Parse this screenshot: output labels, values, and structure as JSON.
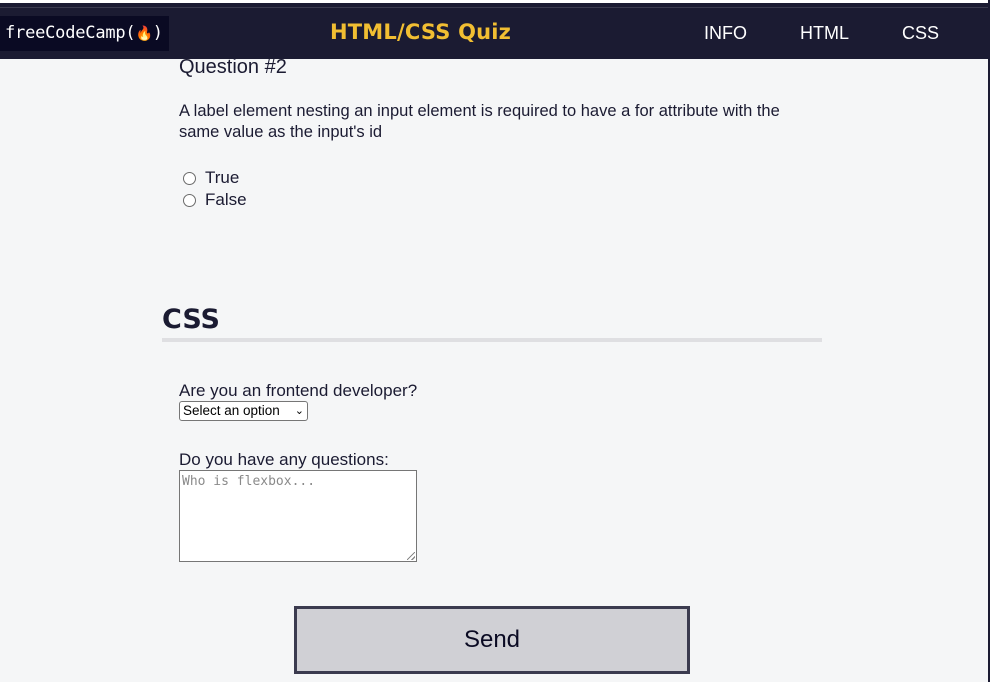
{
  "header": {
    "logo_text": "freeCodeCamp(",
    "logo_flame": "🔥",
    "logo_close": ")",
    "title": "HTML/CSS Quiz",
    "nav": [
      {
        "label": "INFO"
      },
      {
        "label": "HTML"
      },
      {
        "label": "CSS"
      }
    ]
  },
  "question": {
    "title": "Question #2",
    "text": "A label element nesting an input element is required to have a for attribute with the same value as the input's id",
    "options": [
      {
        "label": "True"
      },
      {
        "label": "False"
      }
    ]
  },
  "css_section": {
    "heading": "CSS",
    "developer_label": "Are you an frontend developer?",
    "select_value": "Select an option",
    "questions_label": "Do you have any questions:",
    "textarea_placeholder": "Who is flexbox..."
  },
  "form": {
    "send_label": "Send"
  },
  "colors": {
    "header_bg": "#1b1b32",
    "title_accent": "#f1be32",
    "page_bg": "#f5f6f7",
    "button_bg": "#d0d0d5"
  }
}
